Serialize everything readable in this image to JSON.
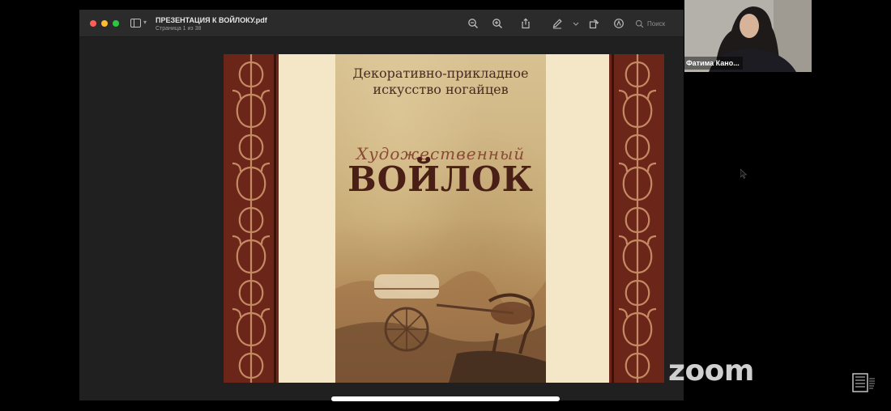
{
  "window": {
    "title": "ПРЕЗЕНТАЦИЯ К ВОЙЛОКУ.pdf",
    "subtitle": "Страница 1 из 38"
  },
  "toolbar": {
    "icons": [
      "zoom-out-icon",
      "zoom-in-icon",
      "share-icon",
      "markup-pen-icon",
      "chevron-down-icon",
      "rotate-icon",
      "annotate-icon",
      "search-icon"
    ],
    "search_placeholder": "Поиск"
  },
  "slide": {
    "subtitle": "Декоративно-прикладное\nискусство ногайцев",
    "script_title": "Художественный",
    "title": "ВОЙЛОК",
    "colors": {
      "border": "#6b2519",
      "paper": "#f3e7c8",
      "text": "#4a2016"
    }
  },
  "participant": {
    "name": "Фатима Кано..."
  },
  "overlay": {
    "zoom_logo": "zoom"
  }
}
